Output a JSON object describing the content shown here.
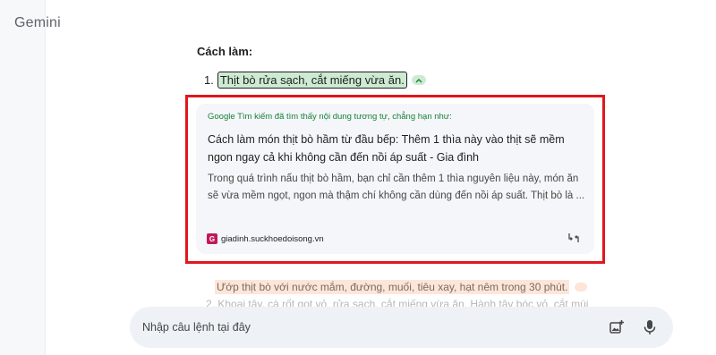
{
  "app": {
    "title": "Gemini"
  },
  "response": {
    "section_title": "Cách làm:",
    "steps": [
      {
        "number": "1.",
        "text": "Thịt bò rửa sạch, cắt miếng vừa ăn."
      },
      {
        "number": "",
        "text": "Ướp thịt bò với nước mắm, đường, muối, tiêu xay, hạt nêm trong 30 phút."
      },
      {
        "number": "2.",
        "text": "Khoai tây, cà rốt gọt vỏ, rửa sạch, cắt miếng vừa ăn. Hành tây bóc vỏ, cắt múi"
      }
    ]
  },
  "source_card": {
    "note": "Google Tìm kiếm đã tìm thấy nội dung tương tự, chẳng hạn như:",
    "title": "Cách làm món thịt bò hầm từ đầu bếp: Thêm 1 thìa này vào thịt sẽ mềm ngon ngay cả khi không cần đến nồi áp suất - Gia đình",
    "snippet": "Trong quá trình nấu thịt bò hầm, bạn chỉ cần thêm 1 thìa nguyên liệu này, món ăn sẽ vừa mềm ngọt, ngon mà thậm chí không cần dùng đến nồi áp suất. Thịt bò là ...",
    "favicon_letter": "G",
    "site": "giadinh.suckhoedoisong.vn"
  },
  "prompt_bar": {
    "placeholder": "Nhập câu lệnh tại đây"
  },
  "icons": {
    "chevron": "chevron-up-icon",
    "compare": "compare-icon",
    "image_upload": "image-upload-icon",
    "mic": "mic-icon"
  },
  "colors": {
    "highlight_green": "#cdebd3",
    "highlight_orange": "#fde6d8",
    "annotation_red": "#e0171c",
    "source_note_green": "#188038",
    "favicon": "#c2185b"
  }
}
